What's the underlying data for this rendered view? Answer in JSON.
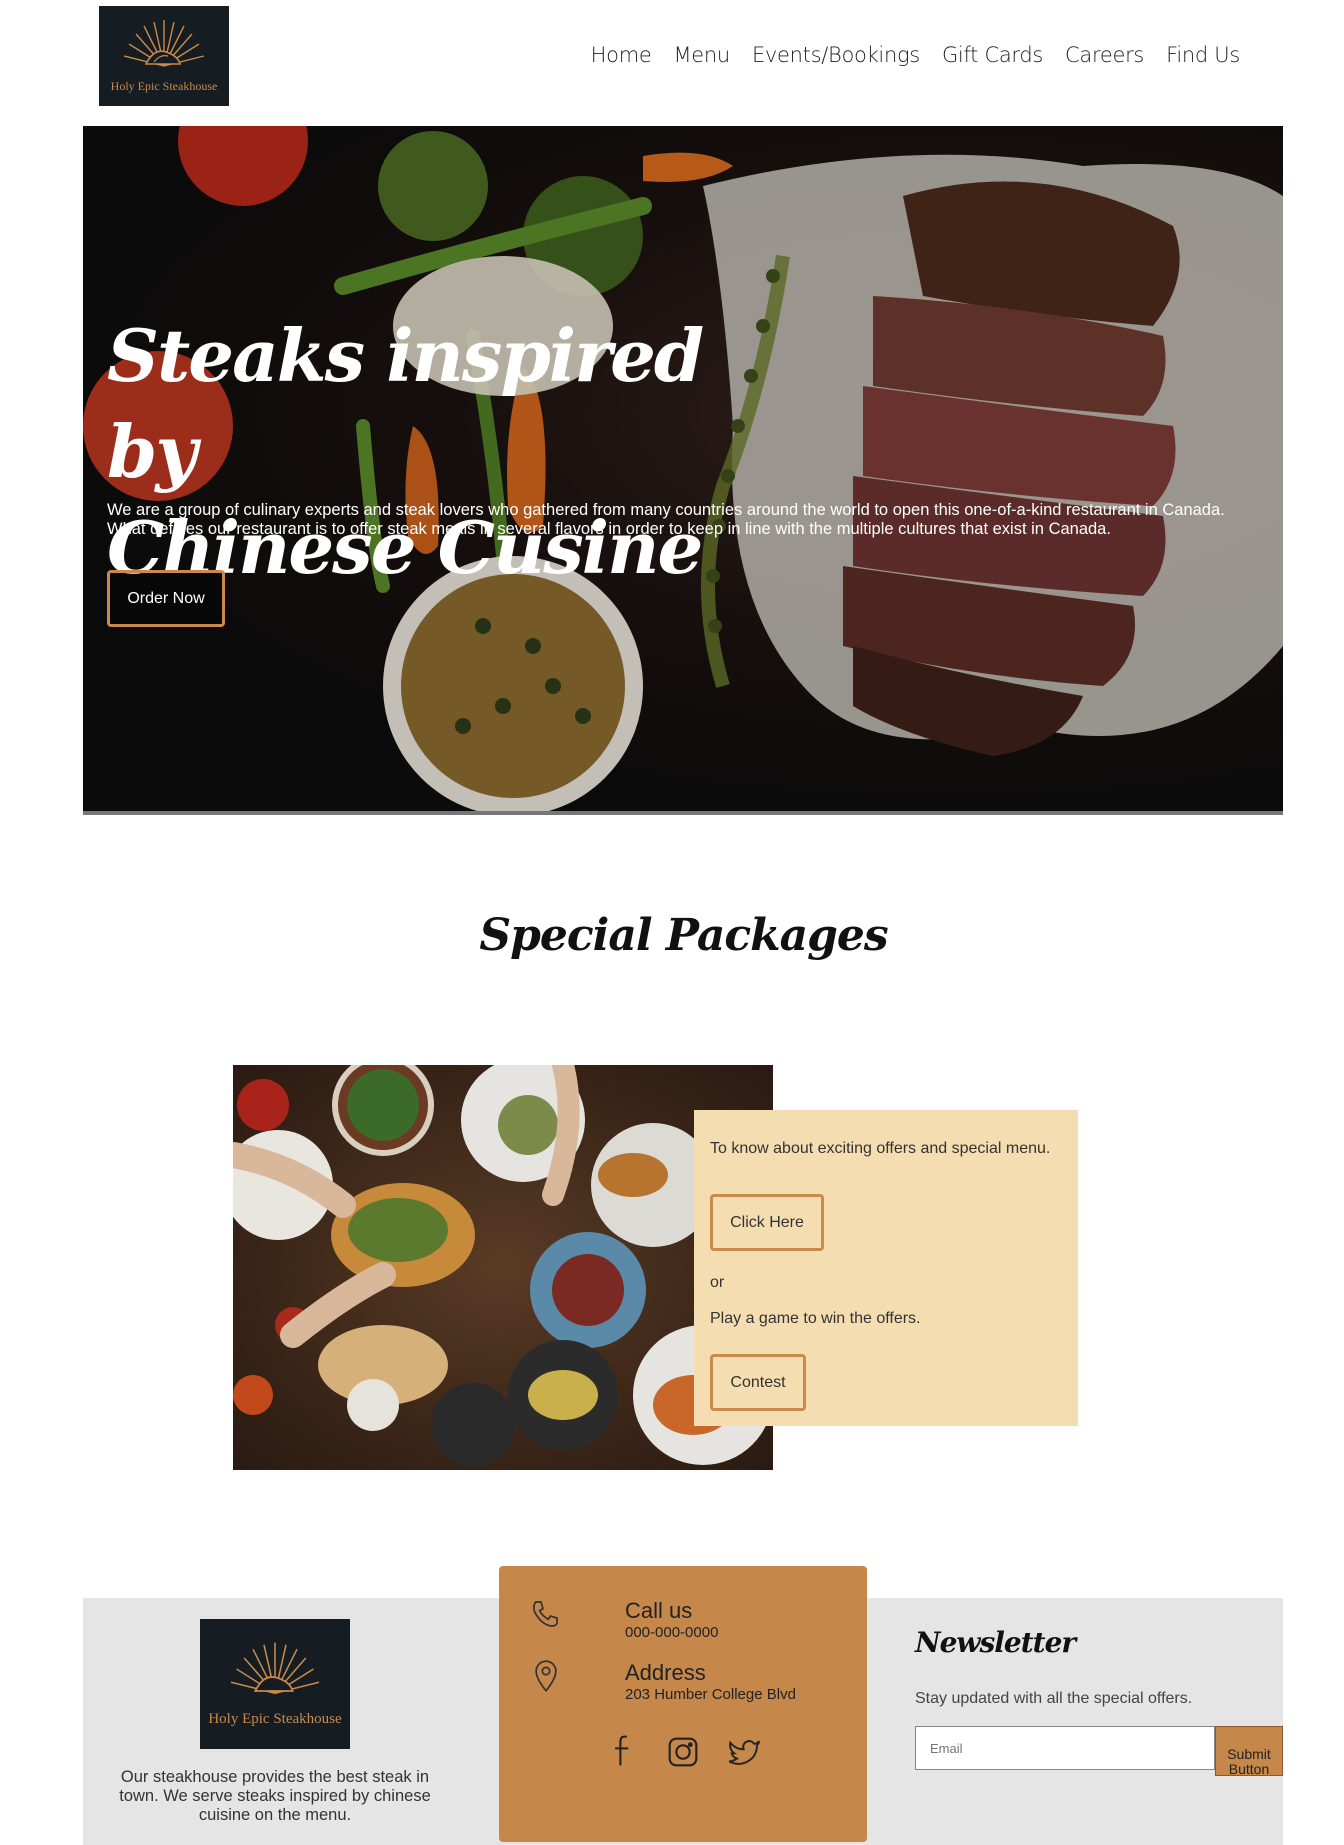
{
  "brand": {
    "name": "Holy Epic Steakhouse",
    "accent": "#c98a4b",
    "dark": "#151c22"
  },
  "nav": {
    "items": [
      "Home",
      "Menu",
      "Events/Bookings",
      "Gift Cards",
      "Careers",
      "Find Us"
    ]
  },
  "hero": {
    "title_line1": "Steaks inspired by",
    "title_line2": "Chinese Cusine",
    "description": "We are a group of culinary experts and steak lovers who gathered from many countries around the world to open this one-of-a-kind restaurant in Canada. What defines our restaurant is to offer steak meals in several flavors in order to keep in line with the multiple cultures that exist in Canada.",
    "button": "Order Now"
  },
  "packages": {
    "title": "Special Packages",
    "offer_text": "To know about exciting offers and special menu.",
    "click_button": "Click Here",
    "or_text": "or",
    "game_text": "Play a game to win the offers.",
    "contest_button": "Contest"
  },
  "footer": {
    "about": "Our steakhouse provides the best steak in town. We serve steaks inspired by chinese cuisine on the menu.",
    "call_label": "Call us",
    "call_value": "000-000-0000",
    "address_label": "Address",
    "address_value": "203 Humber College Blvd",
    "social": [
      "facebook-icon",
      "instagram-icon",
      "twitter-icon"
    ],
    "newsletter_title": "Newsletter",
    "newsletter_text": "Stay updated with all the special offers.",
    "email_placeholder": "Email",
    "submit_alt": "Submit Button"
  }
}
